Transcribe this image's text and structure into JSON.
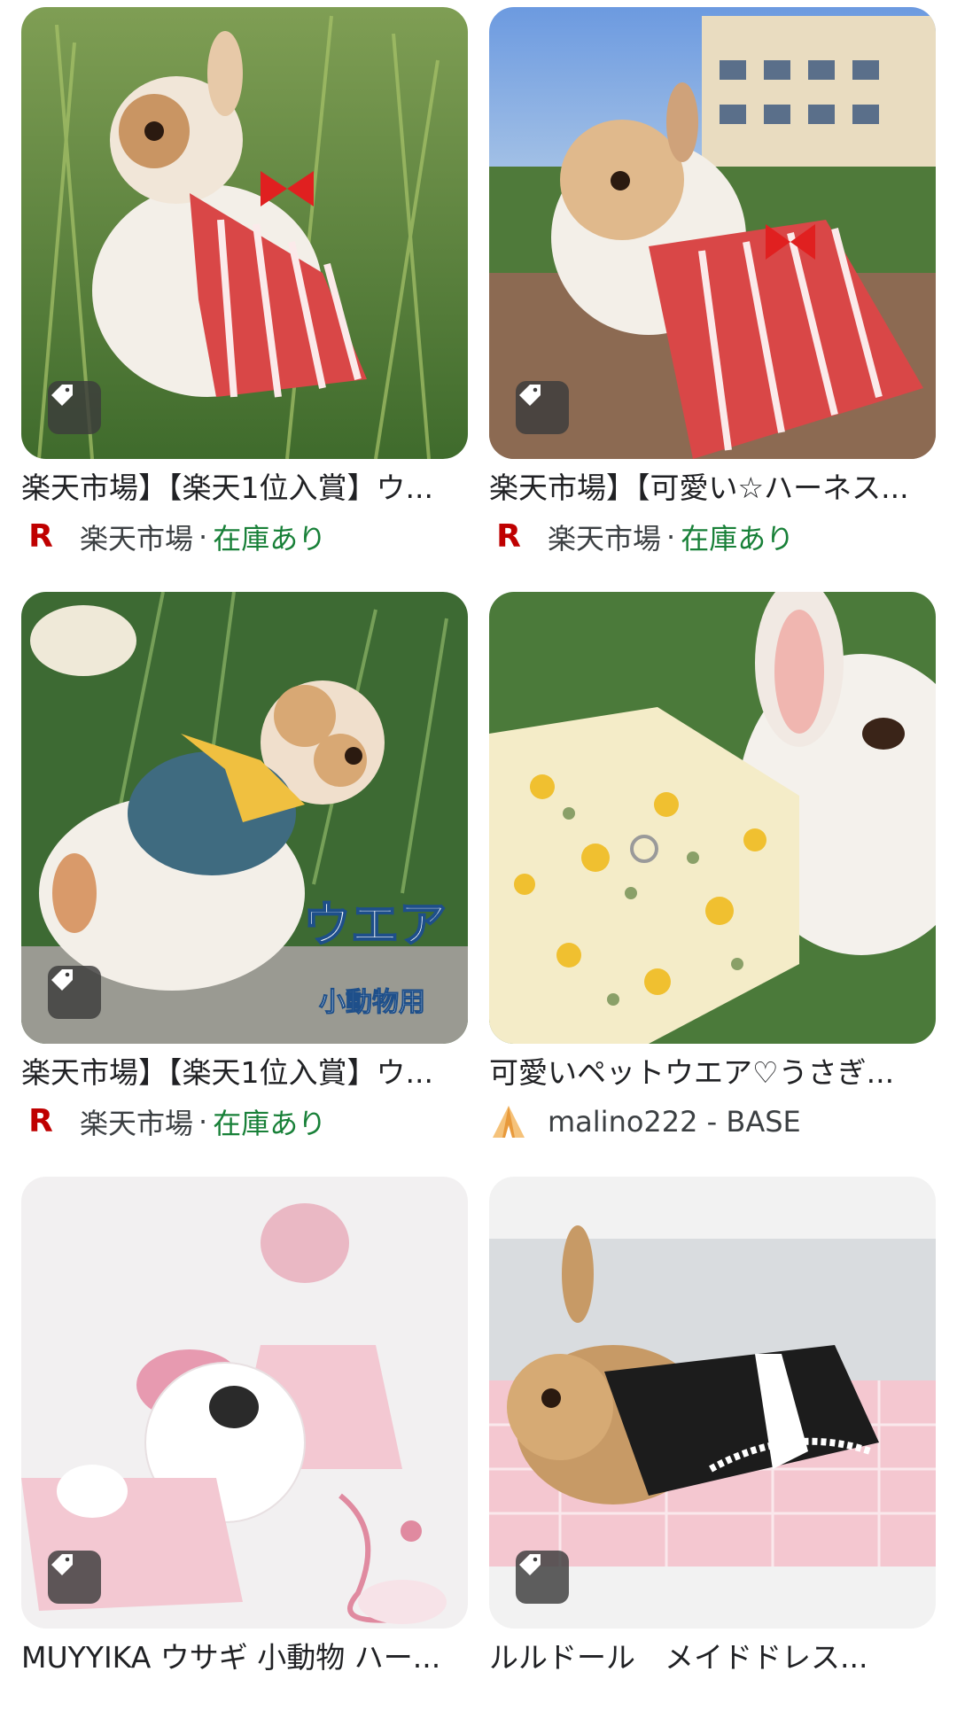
{
  "products": [
    {
      "title": "楽天市場】【楽天1位入賞】ウ...",
      "source_name": "楽天市場",
      "separator": "·",
      "stock": "在庫あり",
      "logo_icon": "rakuten-r-icon",
      "logo_letter": "R"
    },
    {
      "title": "楽天市場】【可愛い☆ハーネス...",
      "source_name": "楽天市場",
      "separator": "·",
      "stock": "在庫あり",
      "logo_icon": "rakuten-r-icon",
      "logo_letter": "R"
    },
    {
      "title": "楽天市場】【楽天1位入賞】ウ...",
      "source_name": "楽天市場",
      "separator": "·",
      "stock": "在庫あり",
      "logo_icon": "rakuten-r-icon",
      "logo_letter": "R",
      "image_text_1": "ウエア",
      "image_text_2": "小動物用"
    },
    {
      "title": "可愛いペットウエア♡うさぎ...",
      "source_name": "malino222 - BASE",
      "logo_icon": "base-tent-icon"
    },
    {
      "title": "MUYYIKA ウサギ 小動物 ハー...",
      "logo_icon": "rakuten-r-icon"
    },
    {
      "title": "ルルドール　メイドドレス...",
      "logo_icon": "rakuten-r-icon"
    }
  ],
  "colors": {
    "in_stock": "#188038",
    "rakuten_red": "#bf0000",
    "badge_bg": "#3c3c3c"
  },
  "icons": {
    "badge": "price-tag-icon"
  }
}
